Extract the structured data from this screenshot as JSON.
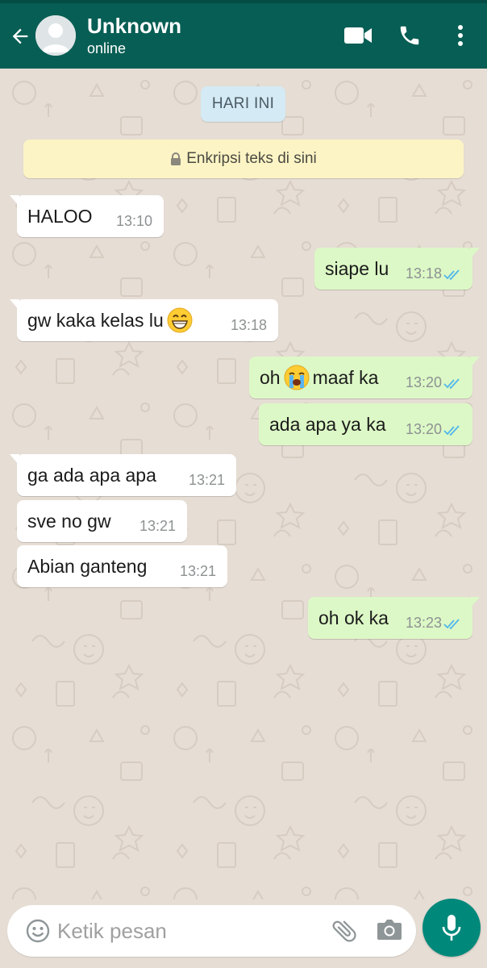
{
  "header": {
    "contact_name": "Unknown",
    "contact_status": "online",
    "icons": [
      "back-arrow-icon",
      "avatar",
      "video-call-icon",
      "voice-call-icon",
      "more-options-icon"
    ],
    "bg_color": "#075e54"
  },
  "chat": {
    "date_label": "HARI INI",
    "encryption_notice": "Enkripsi teks di sini",
    "messages": [
      {
        "dir": "in",
        "text": "HALOO",
        "time": "13:10"
      },
      {
        "dir": "out",
        "text": "siape lu",
        "time": "13:18",
        "status": "read"
      },
      {
        "dir": "in",
        "text_before": "gw kaka kelas lu",
        "emoji": "grinning-face-with-smiling-eyes",
        "text_after": "",
        "time": "13:18"
      },
      {
        "dir": "out",
        "text_before": "oh",
        "emoji": "loudly-crying-face",
        "text_after": "maaf ka",
        "time": "13:20",
        "status": "read"
      },
      {
        "dir": "out",
        "text": "ada apa ya ka",
        "time": "13:20",
        "status": "read"
      },
      {
        "dir": "in",
        "text": "ga ada apa apa",
        "time": "13:21"
      },
      {
        "dir": "in",
        "text": "sve no gw",
        "time": "13:21"
      },
      {
        "dir": "in",
        "text": "Abian ganteng",
        "time": "13:21"
      },
      {
        "dir": "out",
        "text": "oh ok ka",
        "time": "13:23",
        "status": "read"
      }
    ]
  },
  "composer": {
    "placeholder": "Ketik pesan",
    "value": "",
    "icons": [
      "emoji-icon",
      "attach-icon",
      "camera-icon",
      "mic-icon"
    ],
    "accent_color": "#00897b"
  }
}
